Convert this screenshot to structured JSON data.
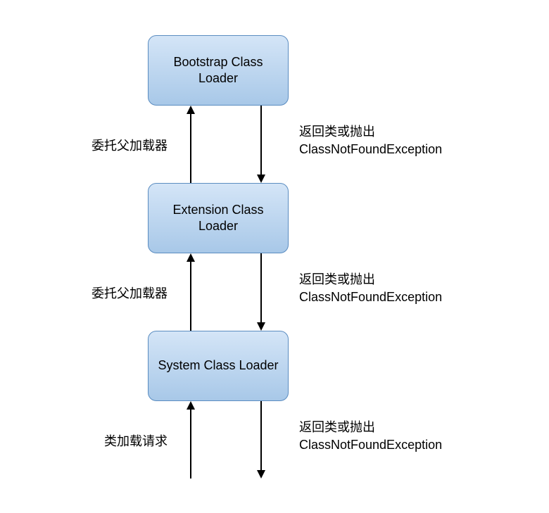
{
  "boxes": {
    "bootstrap": "Bootstrap Class Loader",
    "extension": "Extension Class Loader",
    "system": "System Class Loader"
  },
  "labels": {
    "delegate": "委托父加载器",
    "return_line1": "返回类或抛出",
    "return_line2": "ClassNotFoundException",
    "request": "类加载请求"
  }
}
